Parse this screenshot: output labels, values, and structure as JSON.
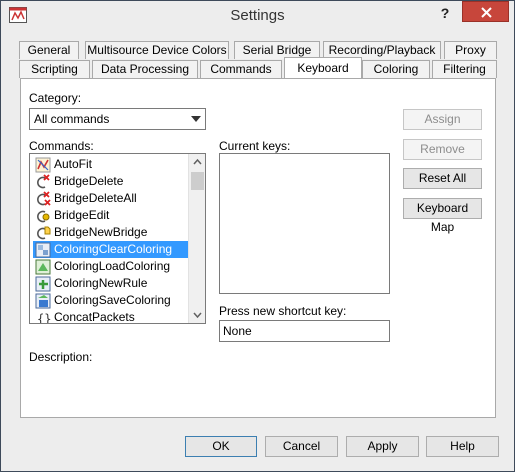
{
  "window": {
    "title": "Settings",
    "help_glyph": "?",
    "app_icon": "settings-app-icon"
  },
  "tabs_top": [
    "General",
    "Multisource Device Colors",
    "Serial Bridge",
    "Recording/Playback",
    "Proxy"
  ],
  "tabs_bottom": [
    "Scripting",
    "Data Processing",
    "Commands",
    "Keyboard",
    "Coloring",
    "Filtering"
  ],
  "active_tab": "Keyboard",
  "category": {
    "label": "Category:",
    "value": "All commands"
  },
  "commands": {
    "label": "Commands:",
    "items": [
      {
        "label": "AutoFit",
        "icon": "autofit-icon"
      },
      {
        "label": "BridgeDelete",
        "icon": "bridge-delete-icon"
      },
      {
        "label": "BridgeDeleteAll",
        "icon": "bridge-delete-all-icon"
      },
      {
        "label": "BridgeEdit",
        "icon": "bridge-edit-icon"
      },
      {
        "label": "BridgeNewBridge",
        "icon": "bridge-new-icon"
      },
      {
        "label": "ColoringClearColoring",
        "icon": "coloring-clear-icon",
        "selected": true
      },
      {
        "label": "ColoringLoadColoring",
        "icon": "coloring-load-icon"
      },
      {
        "label": "ColoringNewRule",
        "icon": "coloring-new-rule-icon"
      },
      {
        "label": "ColoringSaveColoring",
        "icon": "coloring-save-icon"
      },
      {
        "label": "ConcatPackets",
        "icon": "concat-packets-icon"
      }
    ]
  },
  "current_keys": {
    "label": "Current keys:"
  },
  "shortcut": {
    "label": "Press new shortcut key:",
    "value": "None"
  },
  "description": {
    "label": "Description:"
  },
  "side_buttons": {
    "assign": "Assign",
    "remove": "Remove",
    "reset_all": "Reset All",
    "keyboard_map": "Keyboard Map"
  },
  "footer_buttons": {
    "ok": "OK",
    "cancel": "Cancel",
    "apply": "Apply",
    "help": "Help"
  },
  "colors": {
    "selection": "#3399ff",
    "close_button": "#c7463b",
    "panel_bg": "#ffffff",
    "window_bg": "#ededed"
  }
}
